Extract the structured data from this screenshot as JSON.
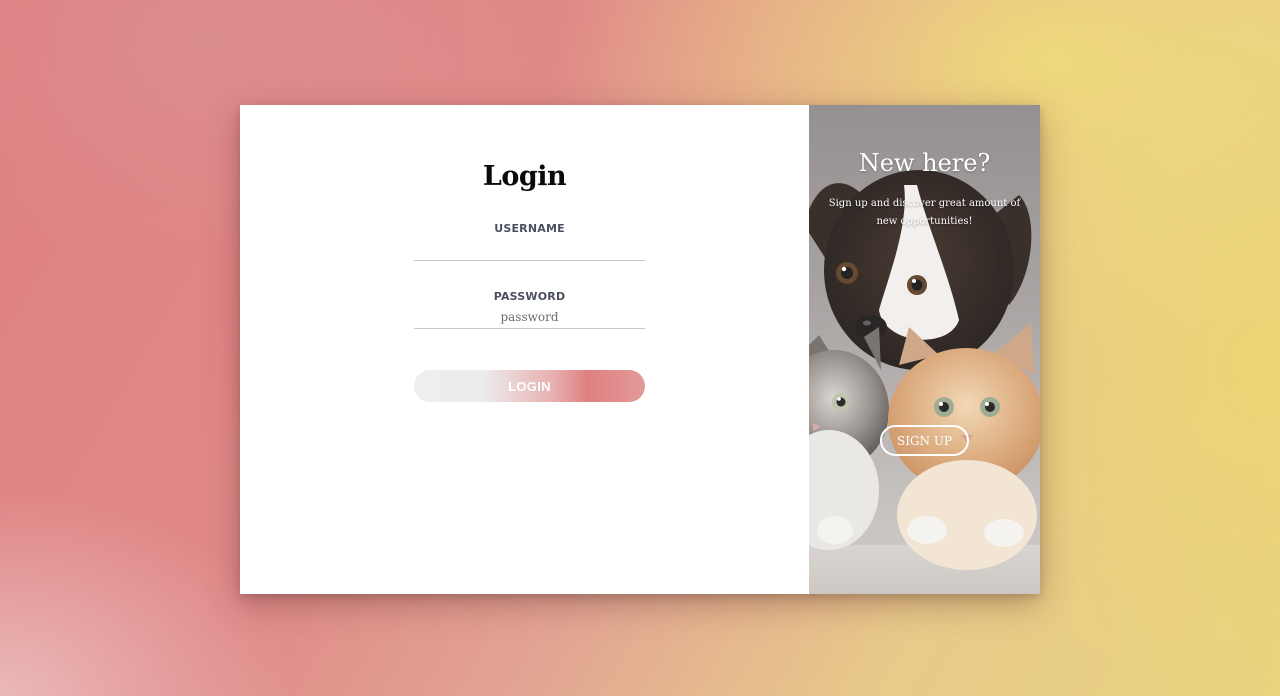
{
  "login": {
    "title": "Login",
    "username_label": "USERNAME",
    "username_value": "",
    "username_placeholder": "",
    "password_label": "PASSWORD",
    "password_placeholder": "password",
    "button_label": "LOGIN"
  },
  "signup": {
    "title": "New here?",
    "description": "Sign up and discover great amount of new opportunities!",
    "button_label": "SIGN UP",
    "image_icon": "puppy-and-kittens-photo"
  },
  "colors": {
    "accent": "#e07f80",
    "background_warm": "#e9d37e",
    "card_background": "#ffffff"
  }
}
